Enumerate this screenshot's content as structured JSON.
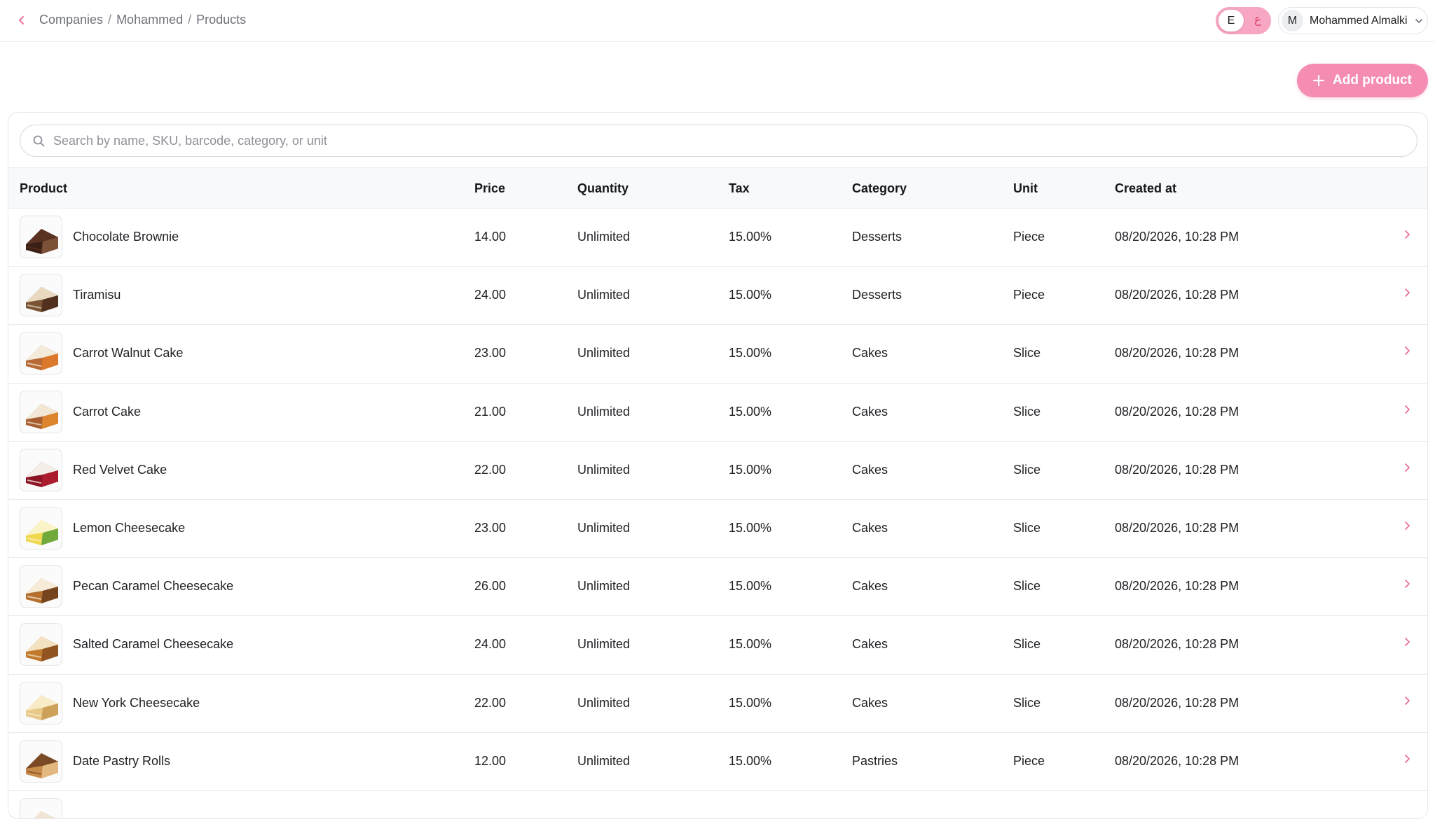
{
  "breadcrumb": [
    "Companies",
    "Mohammed",
    "Products"
  ],
  "language_toggle": {
    "active": "E",
    "alternate": "ع"
  },
  "user": {
    "initial": "M",
    "name": "Mohammed Almalki"
  },
  "add_product_label": "Add product",
  "search": {
    "placeholder": "Search by name, SKU, barcode, category, or unit"
  },
  "columns": {
    "product": "Product",
    "price": "Price",
    "quantity": "Quantity",
    "tax": "Tax",
    "category": "Category",
    "unit": "Unit",
    "created": "Created at"
  },
  "rows": [
    {
      "name": "Chocolate Brownie",
      "price": "14.00",
      "quantity": "Unlimited",
      "tax": "15.00%",
      "category": "Desserts",
      "unit": "Piece",
      "created": "08/20/2026, 10:28 PM",
      "thumb": "brownie"
    },
    {
      "name": "Tiramisu",
      "price": "24.00",
      "quantity": "Unlimited",
      "tax": "15.00%",
      "category": "Desserts",
      "unit": "Piece",
      "created": "08/20/2026, 10:28 PM",
      "thumb": "tiramisu"
    },
    {
      "name": "Carrot Walnut Cake",
      "price": "23.00",
      "quantity": "Unlimited",
      "tax": "15.00%",
      "category": "Cakes",
      "unit": "Slice",
      "created": "08/20/2026, 10:28 PM",
      "thumb": "carrot-walnut"
    },
    {
      "name": "Carrot Cake",
      "price": "21.00",
      "quantity": "Unlimited",
      "tax": "15.00%",
      "category": "Cakes",
      "unit": "Slice",
      "created": "08/20/2026, 10:28 PM",
      "thumb": "carrot"
    },
    {
      "name": "Red Velvet Cake",
      "price": "22.00",
      "quantity": "Unlimited",
      "tax": "15.00%",
      "category": "Cakes",
      "unit": "Slice",
      "created": "08/20/2026, 10:28 PM",
      "thumb": "red-velvet"
    },
    {
      "name": "Lemon Cheesecake",
      "price": "23.00",
      "quantity": "Unlimited",
      "tax": "15.00%",
      "category": "Cakes",
      "unit": "Slice",
      "created": "08/20/2026, 10:28 PM",
      "thumb": "lemon"
    },
    {
      "name": "Pecan Caramel Cheesecake",
      "price": "26.00",
      "quantity": "Unlimited",
      "tax": "15.00%",
      "category": "Cakes",
      "unit": "Slice",
      "created": "08/20/2026, 10:28 PM",
      "thumb": "pecan"
    },
    {
      "name": "Salted Caramel Cheesecake",
      "price": "24.00",
      "quantity": "Unlimited",
      "tax": "15.00%",
      "category": "Cakes",
      "unit": "Slice",
      "created": "08/20/2026, 10:28 PM",
      "thumb": "salted-caramel"
    },
    {
      "name": "New York Cheesecake",
      "price": "22.00",
      "quantity": "Unlimited",
      "tax": "15.00%",
      "category": "Cakes",
      "unit": "Slice",
      "created": "08/20/2026, 10:28 PM",
      "thumb": "new-york"
    },
    {
      "name": "Date Pastry Rolls",
      "price": "12.00",
      "quantity": "Unlimited",
      "tax": "15.00%",
      "category": "Pastries",
      "unit": "Piece",
      "created": "08/20/2026, 10:28 PM",
      "thumb": "date-rolls"
    },
    {
      "name": "",
      "price": "",
      "quantity": "",
      "tax": "",
      "category": "",
      "unit": "",
      "created": "",
      "thumb": "partial"
    }
  ],
  "colors": {
    "accent": "#f48cb3",
    "accent_dark": "#e2456f",
    "chevron": "#ec6f9b"
  },
  "icons": {
    "back": "chevron-left-icon",
    "search": "search-icon",
    "add": "plus-icon",
    "row_open": "chevron-right-icon",
    "user_menu": "chevron-down-icon"
  }
}
